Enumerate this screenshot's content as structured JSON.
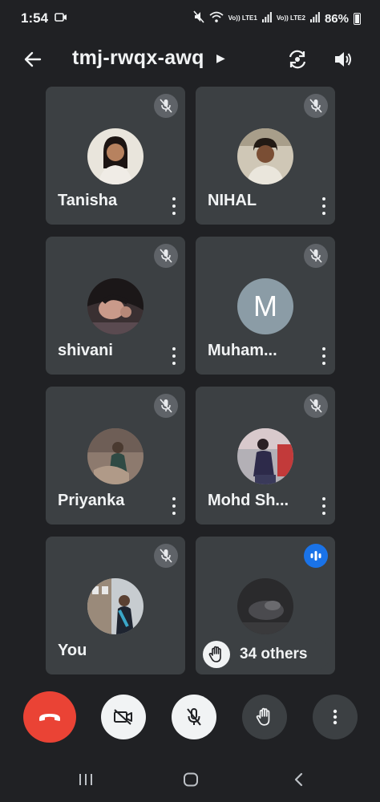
{
  "status_bar": {
    "time": "1:54",
    "sim1": "Vo)) LTE1",
    "sim2": "Vo)) LTE2",
    "battery": "86%"
  },
  "header": {
    "meeting_code": "tmj-rwqx-awq"
  },
  "participants": [
    {
      "name": "Tanisha",
      "muted": true
    },
    {
      "name": "NIHAL",
      "muted": true
    },
    {
      "name": "shivani",
      "muted": true
    },
    {
      "name": "Muham...",
      "muted": true,
      "initial": "M"
    },
    {
      "name": "Priyanka",
      "muted": true
    },
    {
      "name": "Mohd Sh...",
      "muted": true
    },
    {
      "name": "You",
      "muted": true
    },
    {
      "name": "",
      "muted": false,
      "speaking": true
    }
  ],
  "others_pill": {
    "label": "34 others"
  },
  "colors": {
    "background": "#202124",
    "tile": "#3c4043",
    "end_call": "#ea4335",
    "speaking_badge": "#1a73e8",
    "muted_badge": "#5f6368"
  },
  "icons": {
    "back": "arrow-left-icon",
    "flip_camera": "flip-camera-icon",
    "speaker": "speaker-icon",
    "end_call": "phone-hangup-icon",
    "camera_off": "camera-off-icon",
    "mic_off": "mic-off-icon",
    "raise_hand": "hand-icon",
    "more": "more-vert-icon"
  }
}
